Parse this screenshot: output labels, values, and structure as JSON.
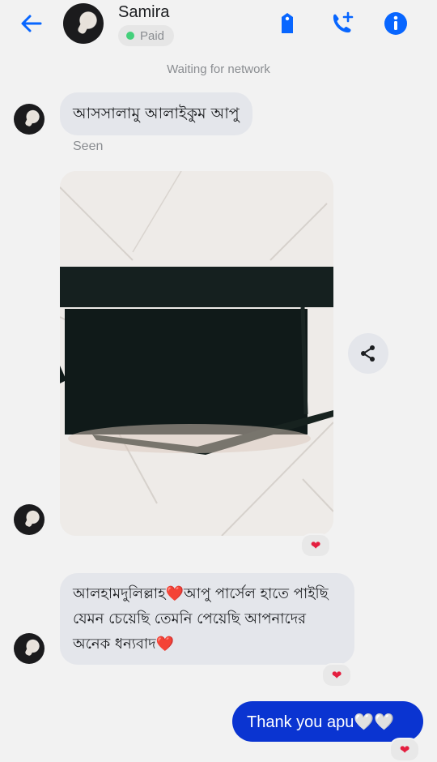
{
  "header": {
    "contact_name": "Samira",
    "badge": "Paid",
    "icons": [
      "back-arrow-icon",
      "tag-icon",
      "add-call-icon",
      "info-icon"
    ],
    "accent_color": "#0866ff"
  },
  "status": "Waiting for network",
  "messages": {
    "greeting": "আসসালামু আলাইকুম আপু",
    "seen": "Seen",
    "photo_reaction": "❤",
    "thanks": "আলহামদুলিল্লাহ❤️আপু পার্সেল হাতে পাইছি যেমন চেয়েছি তেমনি পেয়েছি আপনাদের অনেক ধন্যবাদ❤️",
    "thanks_reaction": "❤",
    "reply": "Thank you apu🤍🤍",
    "reply_reaction": "❤"
  },
  "colors": {
    "outgoing_bubble": "#0a34d1",
    "incoming_bubble": "#e4e6eb",
    "reaction_heart": "#e41e3f"
  }
}
